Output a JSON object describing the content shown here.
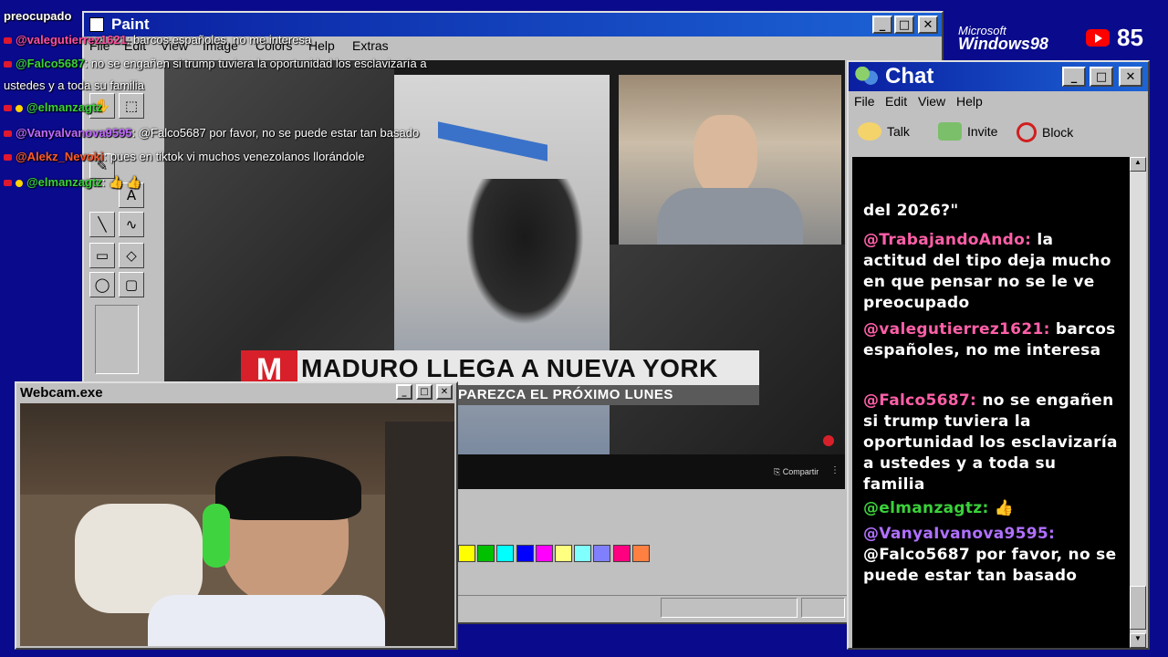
{
  "overlay_chat": {
    "top_line": "preocupado",
    "lines": [
      {
        "user": "@valegutierrez1621",
        "text": ": barcos españoles, no me interesa",
        "color": "#ff4fa3",
        "badge": "dot"
      },
      {
        "user": "@Falco5687",
        "text": ": no se engañen si trump tuviera la oportunidad los esclavizaría a",
        "color": "#3ad13a",
        "badge": "dot"
      },
      {
        "user": "",
        "text": "ustedes y a toda su familia",
        "color": "#ffffff",
        "badge": "none"
      },
      {
        "user": "@elmanzagtz",
        "text": "",
        "color": "#3ad13a",
        "badge": "dot-star"
      },
      {
        "user": "@Vanyalvanova9595",
        "text": ": @Falco5687 por favor, no se puede estar tan basado",
        "color": "#c06bff",
        "badge": "dot"
      },
      {
        "user": "@Alekz_Nevoki",
        "text": ": pues en tiktok vi muchos venezolanos llorándole",
        "color": "#ff5a2a",
        "badge": "dot"
      },
      {
        "user": "@elmanzagtz",
        "text": ": 👍 👍",
        "color": "#3ad13a",
        "badge": "dot-star"
      }
    ]
  },
  "paint": {
    "title": "Paint",
    "menu": [
      "File",
      "Edit",
      "View",
      "Image",
      "Colors",
      "Help",
      "Extras"
    ],
    "tools": [
      "✋",
      "⬚",
      "✎",
      "A",
      "╲",
      "∿",
      "▭",
      "◇",
      "◯",
      "▢"
    ],
    "palette": [
      "#ffff00",
      "#00c000",
      "#00ffff",
      "#0000ff",
      "#ff00ff",
      "#ffff80",
      "#80ffff",
      "#8080ff",
      "#ff0080",
      "#ff8040"
    ],
    "video": {
      "logo": "M",
      "headline": "MADURO LLEGA A NUEVA YORK",
      "subline": "PAREZCA EL PRÓXIMO LUNES",
      "share_label": "Compartir"
    }
  },
  "branding": {
    "ms_line": "Microsoft",
    "win_line": "Windows98",
    "viewer_count": "85"
  },
  "chat_window": {
    "title": "Chat",
    "menu": [
      "File",
      "Edit",
      "View",
      "Help"
    ],
    "toolbar": [
      "Talk",
      "Invite",
      "Block"
    ],
    "messages": [
      {
        "user": "",
        "text": "del 2026?\"",
        "color": "#ffffff"
      },
      {
        "user": "@TrabajandoAndo:",
        "text": "la actitud del tipo deja mucho en que pensar no se le ve preocupado",
        "color": "#ff5fa8"
      },
      {
        "user": "@valegutierrez1621:",
        "text": "barcos españoles, no me interesa",
        "color": "#ff5fa8"
      },
      {
        "user": "@Falco5687:",
        "text": "no se engañen si trump tuviera la oportunidad los esclavizaría a ustedes y a toda su familia",
        "color": "#ff5fa8"
      },
      {
        "user": "@elmanzagtz:",
        "text": "👍",
        "color": "#3ad13a"
      },
      {
        "user": "@VanyaIvanova9595:",
        "text": "@Falco5687 por favor, no se puede estar tan basado",
        "color": "#b070ff"
      }
    ]
  },
  "webcam": {
    "title": "Webcam.exe"
  }
}
